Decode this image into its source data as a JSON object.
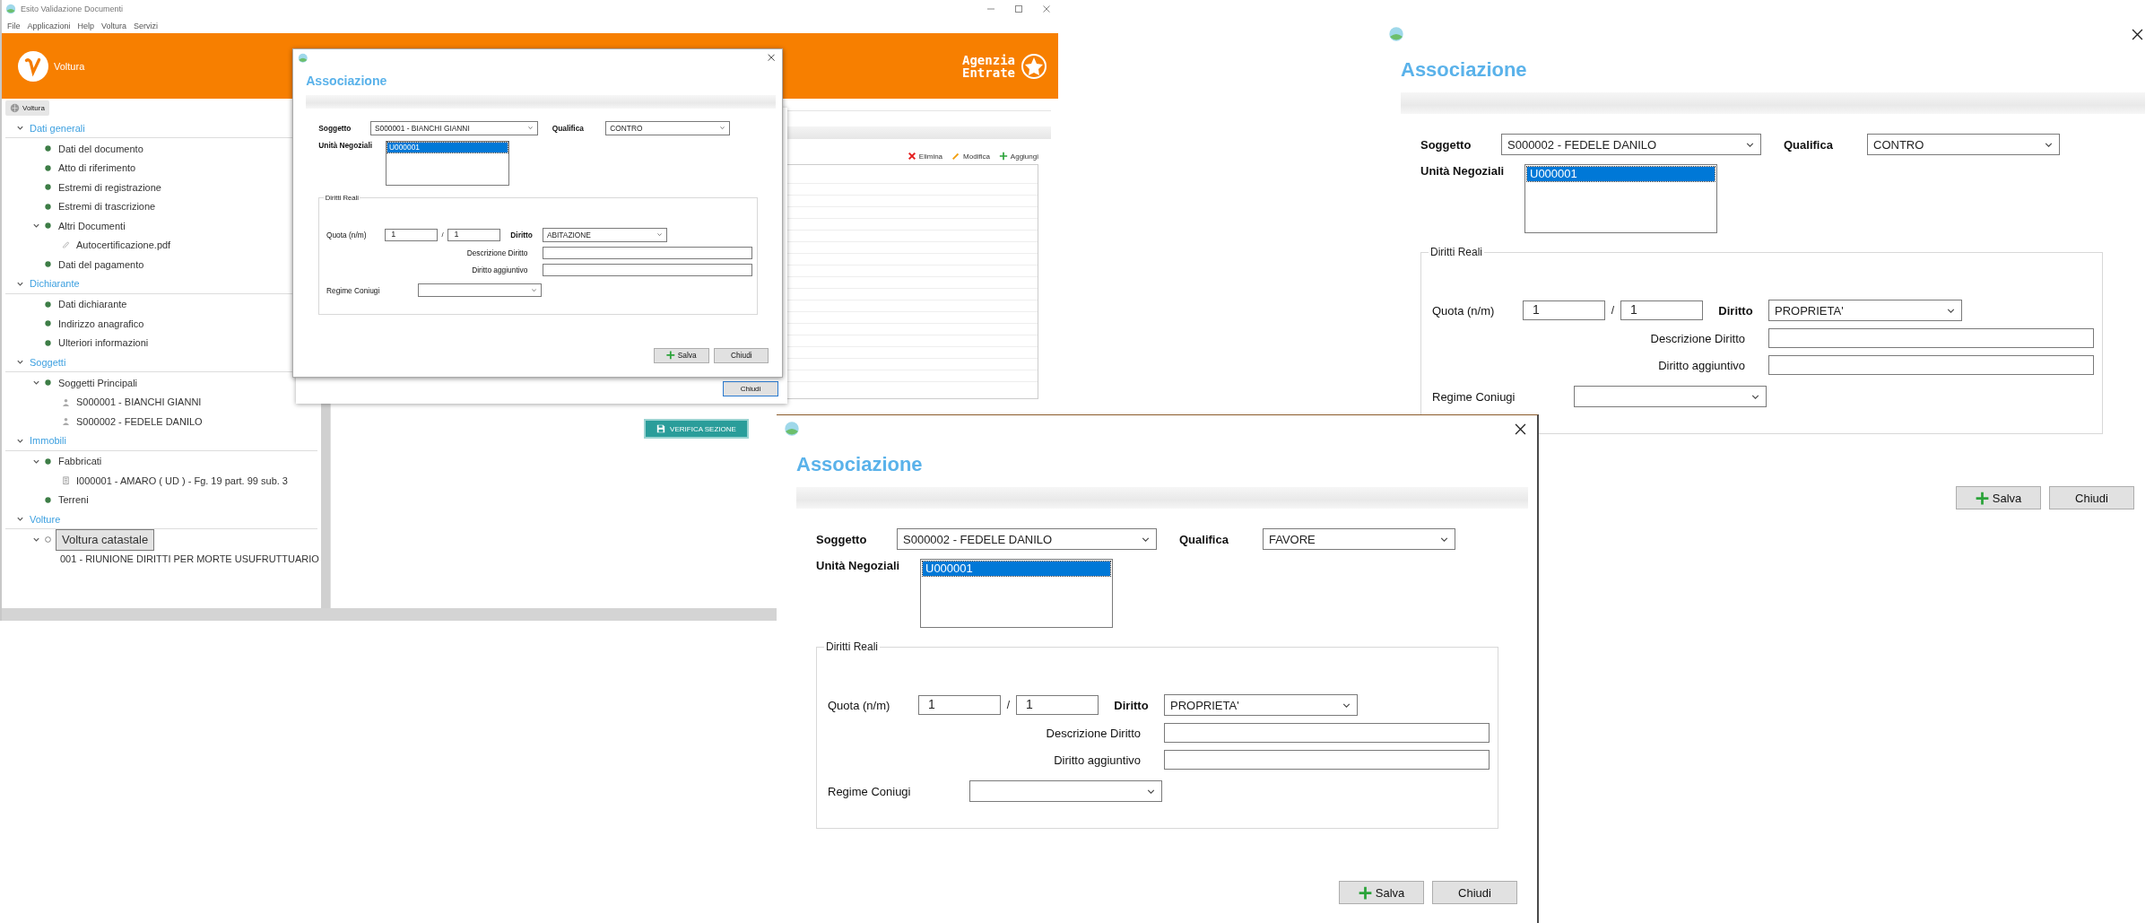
{
  "app": {
    "title": "Esito Validazione Documenti",
    "menu": [
      "File",
      "Applicazioni",
      "Help",
      "Voltura",
      "Servizi"
    ],
    "header": {
      "app_name": "Voltura",
      "brand": "Agenzia Entrate"
    },
    "tab": "Voltura",
    "tree": [
      {
        "heading": "Dati generali",
        "expanded": true,
        "items": [
          {
            "label": "Dati del documento",
            "kind": "dot",
            "selected": false
          },
          {
            "label": "Atto di riferimento",
            "kind": "dot",
            "selected": false
          },
          {
            "label": "Estremi di registrazione",
            "kind": "dot",
            "selected": false
          },
          {
            "label": "Estremi di trascrizione",
            "kind": "dot",
            "selected": false
          },
          {
            "label": "Altri Documenti",
            "kind": "dot",
            "selected": false,
            "expanded": true,
            "children": [
              {
                "label": "Autocertificazione.pdf",
                "kind": "attachment",
                "selected": false
              }
            ]
          },
          {
            "label": "Dati del pagamento",
            "kind": "dot",
            "selected": false
          }
        ]
      },
      {
        "heading": "Dichiarante",
        "expanded": true,
        "items": [
          {
            "label": "Dati dichiarante",
            "kind": "dot",
            "selected": false
          },
          {
            "label": "Indirizzo anagrafico",
            "kind": "dot",
            "selected": false
          },
          {
            "label": "Ulteriori informazioni",
            "kind": "dot",
            "selected": false
          }
        ]
      },
      {
        "heading": "Soggetti",
        "expanded": true,
        "items": [
          {
            "label": "Soggetti Principali",
            "kind": "dot",
            "selected": false,
            "expanded": true,
            "children": [
              {
                "label": "S000001 - BIANCHI GIANNI",
                "kind": "person",
                "selected": false
              },
              {
                "label": "S000002 - FEDELE DANILO",
                "kind": "person",
                "selected": false
              }
            ]
          }
        ]
      },
      {
        "heading": "Immobili",
        "expanded": true,
        "items": [
          {
            "label": "Fabbricati",
            "kind": "dot",
            "selected": false,
            "expanded": true,
            "children": [
              {
                "label": "I000001 - AMARO ( UD ) - Fg. 19 part. 99 sub. 3",
                "kind": "building",
                "selected": false
              }
            ]
          },
          {
            "label": "Terreni",
            "kind": "dot",
            "selected": false
          }
        ]
      },
      {
        "heading": "Volture",
        "expanded": true,
        "items": [
          {
            "label": "Voltura catastale",
            "kind": "circle",
            "selected": true,
            "expanded": true,
            "children": [
              {
                "label": "001 - RIUNIONE DIRITTI PER MORTE USUFRUTTUARIO",
                "kind": "folder",
                "selected": false
              }
            ]
          }
        ]
      }
    ],
    "toolbar": [
      {
        "label": "Elimina",
        "kind": "delete"
      },
      {
        "label": "Modifica",
        "kind": "edit"
      },
      {
        "label": "Aggiungi",
        "kind": "add"
      }
    ],
    "back_dialog_button": "Chiudi",
    "verify_button": "VERIFICA SEZIONE"
  },
  "dialogs": [
    {
      "title": "Associazione",
      "soggetto_label": "Soggetto",
      "soggetto": "S000001 - BIANCHI GIANNI",
      "qualifica_label": "Qualifica",
      "qualifica": "CONTRO",
      "unita_label": "Unità Negoziali",
      "unita": [
        {
          "label": "U000001",
          "selected": true
        }
      ],
      "group": "Diritti Reali",
      "quota_label": "Quota (n/m)",
      "quota_n": "1",
      "separator": "/",
      "quota_m": "1",
      "diritto_label": "Diritto",
      "diritto": "ABITAZIONE",
      "descrizione_label": "Descrizione Diritto",
      "aggiuntivo_label": "Diritto aggiuntivo",
      "regime_label": "Regime Coniugi",
      "buttons": [
        {
          "label": "Salva",
          "kind": "save"
        },
        {
          "label": "Chiudi",
          "kind": "close"
        }
      ]
    },
    {
      "title": "Associazione",
      "soggetto_label": "Soggetto",
      "soggetto": "S000002 - FEDELE DANILO",
      "qualifica_label": "Qualifica",
      "qualifica": "CONTRO",
      "unita_label": "Unità Negoziali",
      "unita": [
        {
          "label": "U000001",
          "selected": true
        }
      ],
      "group": "Diritti Reali",
      "quota_label": "Quota (n/m)",
      "quota_n": "1",
      "separator": "/",
      "quota_m": "1",
      "diritto_label": "Diritto",
      "diritto": "PROPRIETA'",
      "descrizione_label": "Descrizione Diritto",
      "aggiuntivo_label": "Diritto aggiuntivo",
      "regime_label": "Regime Coniugi",
      "buttons": [
        {
          "label": "Salva",
          "kind": "save"
        },
        {
          "label": "Chiudi",
          "kind": "close"
        }
      ]
    },
    {
      "title": "Associazione",
      "soggetto_label": "Soggetto",
      "soggetto": "S000002 - FEDELE DANILO",
      "qualifica_label": "Qualifica",
      "qualifica": "FAVORE",
      "unita_label": "Unità Negoziali",
      "unita": [
        {
          "label": "U000001",
          "selected": true
        }
      ],
      "group": "Diritti Reali",
      "quota_label": "Quota (n/m)",
      "quota_n": "1",
      "separator": "/",
      "quota_m": "1",
      "diritto_label": "Diritto",
      "diritto": "PROPRIETA'",
      "descrizione_label": "Descrizione Diritto",
      "aggiuntivo_label": "Diritto aggiuntivo",
      "regime_label": "Regime Coniugi",
      "buttons": [
        {
          "label": "Salva",
          "kind": "save"
        },
        {
          "label": "Chiudi",
          "kind": "close"
        }
      ]
    }
  ]
}
